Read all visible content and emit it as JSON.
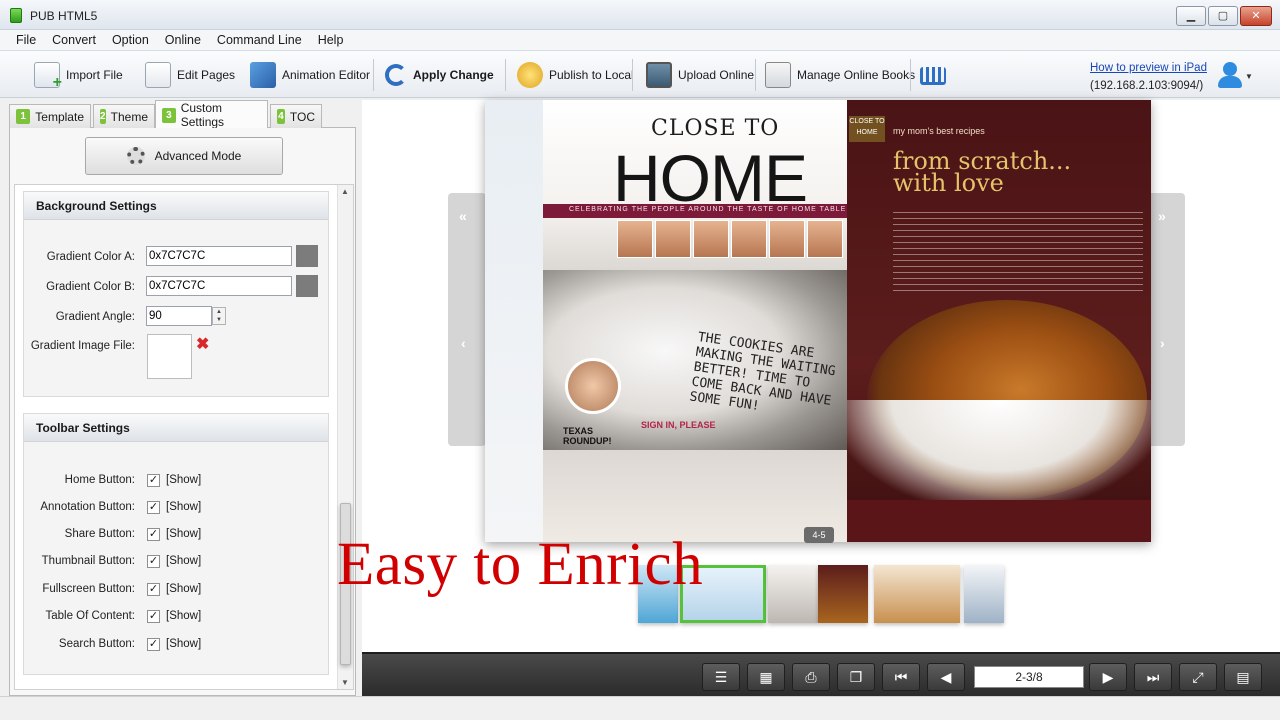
{
  "window": {
    "title": "PUB HTML5",
    "controls": {
      "minimize": "▁",
      "maximize": "▢",
      "close": "✕"
    }
  },
  "menu": [
    "File",
    "Convert",
    "Option",
    "Online",
    "Command Line",
    "Help"
  ],
  "toolbar": {
    "import_file": "Import File",
    "edit_pages": "Edit Pages",
    "animation_editor": "Animation Editor",
    "apply_change": "Apply Change",
    "publish_local": "Publish to Local",
    "upload_online": "Upload Online",
    "manage_online": "Manage Online Books",
    "preview_link": "How to preview in iPad",
    "preview_ip": "(192.168.2.103:9094/)"
  },
  "tabs": [
    {
      "num": "1",
      "label": "Template"
    },
    {
      "num": "2",
      "label": "Theme"
    },
    {
      "num": "3",
      "label": "Custom Settings"
    },
    {
      "num": "4",
      "label": "TOC"
    }
  ],
  "advanced_mode": "Advanced Mode",
  "background_settings": {
    "header": "Background Settings",
    "gradient_a_label": "Gradient Color A:",
    "gradient_a_value": "0x7C7C7C",
    "gradient_b_label": "Gradient Color B:",
    "gradient_b_value": "0x7C7C7C",
    "angle_label": "Gradient Angle:",
    "angle_value": "90",
    "image_label": "Gradient Image File:"
  },
  "toolbar_settings": {
    "header": "Toolbar Settings",
    "items": [
      {
        "label": "Home Button:",
        "checked": true,
        "show": "[Show]"
      },
      {
        "label": "Annotation Button:",
        "checked": true,
        "show": "[Show]"
      },
      {
        "label": "Share Button:",
        "checked": true,
        "show": "[Show]"
      },
      {
        "label": "Thumbnail Button:",
        "checked": true,
        "show": "[Show]"
      },
      {
        "label": "Fullscreen Button:",
        "checked": true,
        "show": "[Show]"
      },
      {
        "label": "Table Of Content:",
        "checked": true,
        "show": "[Show]"
      },
      {
        "label": "Search Button:",
        "checked": true,
        "show": "[Show]"
      }
    ]
  },
  "magazine": {
    "brand_line1": "CLOSE TO",
    "brand_line2": "HOME",
    "ribbon": "CELEBRATING THE PEOPLE AROUND THE TASTE OF HOME TABLE",
    "sign_in": "SIGN IN, PLEASE",
    "texas": "TEXAS ROUNDUP!",
    "handwriting": "THE COOKIES ARE MAKING THE WAITING BETTER! TIME TO COME BACK AND HAVE SOME FUN!",
    "right_kicker": "my mom's best recipes",
    "right_head1": "from scratch...",
    "right_head2": "with love",
    "small_brand": "CLOSE TO HOME"
  },
  "page_badge": "4-5",
  "overlay_text": "Easy to Enrich",
  "viewer": {
    "page_indicator": "2-3/8"
  },
  "colors": {
    "gradient_swatch": "#7c7c7c",
    "accent_red": "#d10000",
    "tab_green": "#7cc23a"
  }
}
